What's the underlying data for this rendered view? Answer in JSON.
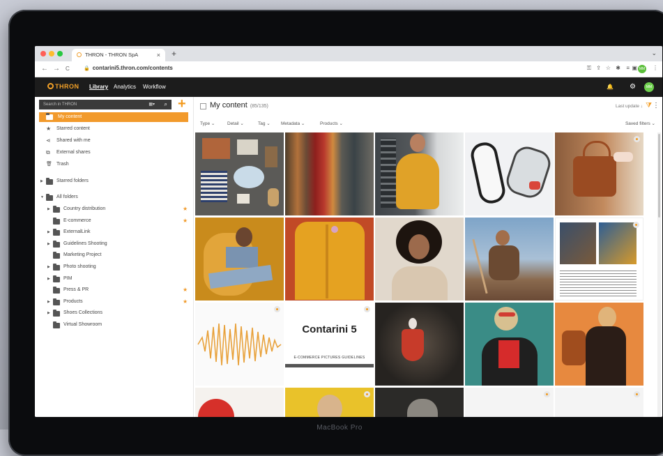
{
  "laptop": {
    "model": "MacBook Pro"
  },
  "browser": {
    "tab_title": "THRON - THRON SpA",
    "tab_close": "×",
    "new_tab": "+",
    "tabs_menu": "⌄",
    "url": "contarini5.thron.com/contents",
    "lock": "🔒",
    "back": "←",
    "forward": "→",
    "reload": "C",
    "ext_icons": [
      "⚿",
      "⇪",
      "☆",
      "✱",
      "≡",
      "▣",
      "⋮"
    ],
    "avatar": "MM"
  },
  "app": {
    "logo": "THRON",
    "menu": [
      "Library",
      "Analytics",
      "Workflow"
    ],
    "bell": "🔔",
    "gear": "⚙",
    "avatar": "MM"
  },
  "sidebar": {
    "search_placeholder": "Search in THRON",
    "search_drop": "▦▾",
    "search_icon": "⌕",
    "add": "+",
    "top_items": [
      {
        "label": "My content",
        "icon": "folder"
      },
      {
        "label": "Starred content",
        "icon": "★"
      },
      {
        "label": "Shared with me",
        "icon": "⋖"
      },
      {
        "label": "External shares",
        "icon": "⧉"
      },
      {
        "label": "Trash",
        "icon": "🗑"
      }
    ],
    "starred_folders": "Starred folders",
    "all_folders": "All folders",
    "folders": [
      {
        "label": "Country distribution",
        "starred": true,
        "expand": true
      },
      {
        "label": "E-commerce",
        "starred": true,
        "expand": false
      },
      {
        "label": "ExternalLink",
        "starred": false,
        "expand": true
      },
      {
        "label": "Guidelines Shooting",
        "starred": false,
        "expand": true
      },
      {
        "label": "Marketing Project",
        "starred": false,
        "expand": false
      },
      {
        "label": "Photo shooting",
        "starred": false,
        "expand": true
      },
      {
        "label": "PIM",
        "starred": false,
        "expand": true
      },
      {
        "label": "Press & PR",
        "starred": true,
        "expand": false
      },
      {
        "label": "Products",
        "starred": true,
        "expand": true
      },
      {
        "label": "Shoes Collections",
        "starred": false,
        "expand": true
      },
      {
        "label": "Virtual Showroom",
        "starred": false,
        "expand": false
      }
    ],
    "star_glyph": "★"
  },
  "main": {
    "title": "My content",
    "count": "(85/135)",
    "sort": "Last update ↓",
    "filter_icon": "⧩",
    "more": "⋮",
    "filters": [
      "Type ⌄",
      "Detail ⌄",
      "Tag ⌄",
      "Metadata ⌄",
      "Products ⌄"
    ],
    "saved_filters": "Saved filters ⌄",
    "tiles_text": {
      "contarini_title": "Contarini 5",
      "contarini_sub": "E-COMMERCE PICTURES GUIDELINES"
    }
  }
}
